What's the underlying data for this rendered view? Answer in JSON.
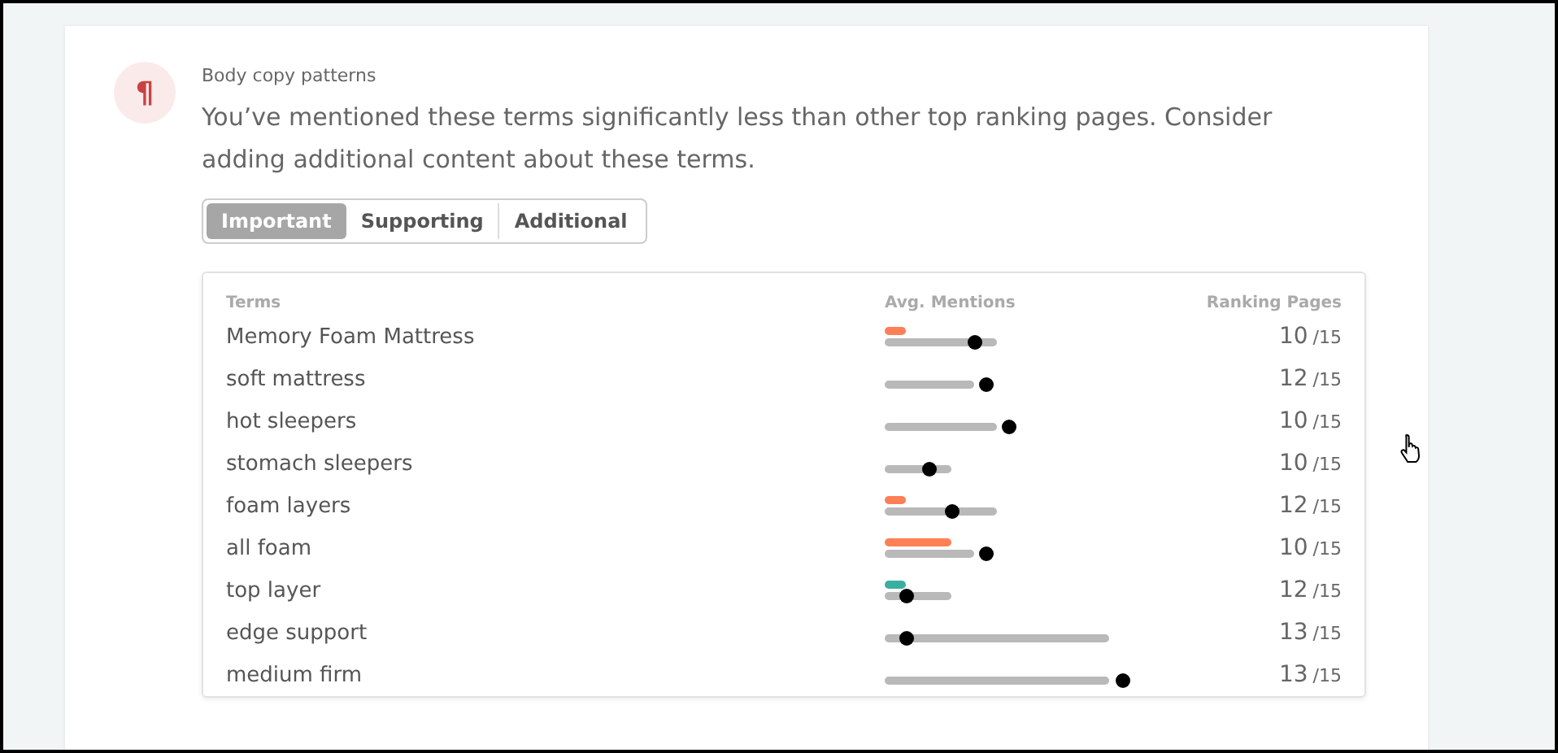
{
  "section": {
    "icon": "¶",
    "title": "Body copy patterns",
    "message": "You’ve mentioned these terms significantly less than other top ranking pages. Consider adding additional content about these terms."
  },
  "tabs": [
    {
      "label": "Important",
      "selected": true
    },
    {
      "label": "Supporting",
      "selected": false
    },
    {
      "label": "Additional",
      "selected": false
    }
  ],
  "table": {
    "columns": [
      "Terms",
      "Avg. Mentions",
      "Ranking Pages"
    ],
    "rows": [
      {
        "term": "Memory Foam Mattress",
        "yours": {
          "color": "#ff7f56"
        },
        "count": "10",
        "total": "/15"
      },
      {
        "term": "soft mattress",
        "count": "12",
        "total": "/15"
      },
      {
        "term": "hot sleepers",
        "count": "10",
        "total": "/15"
      },
      {
        "term": "stomach sleepers",
        "count": "10",
        "total": "/15"
      },
      {
        "term": "foam layers",
        "yours": {
          "color": "#ff7f56"
        },
        "count": "12",
        "total": "/15"
      },
      {
        "term": "all foam",
        "yours": {
          "color": "#ff7f56"
        },
        "count": "10",
        "total": "/15"
      },
      {
        "term": "top layer",
        "yours": {
          "color": "#3aafa0"
        },
        "count": "12",
        "total": "/15"
      },
      {
        "term": "edge support",
        "count": "13",
        "total": "/15"
      },
      {
        "term": "medium firm",
        "count": "13",
        "total": "/15"
      }
    ]
  }
}
